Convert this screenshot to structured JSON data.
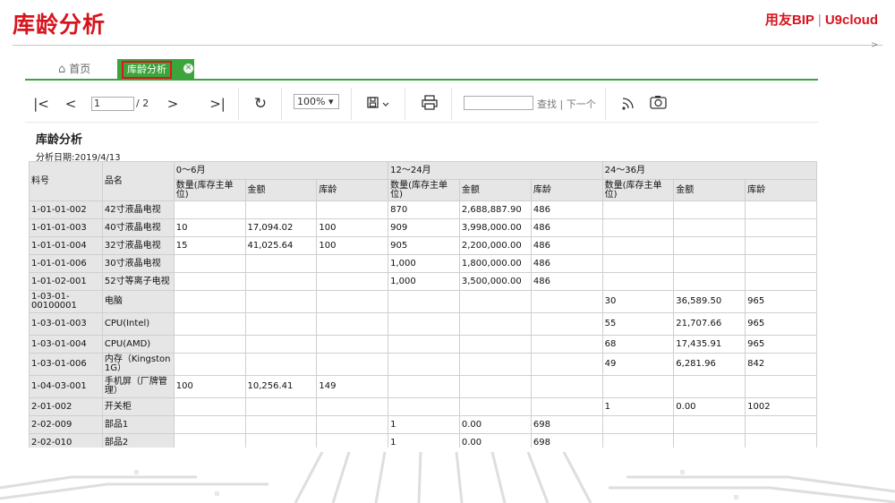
{
  "slide": {
    "title": "库龄分析",
    "brand_left": "用友BIP",
    "brand_right": "U9cloud"
  },
  "tabs": {
    "home": "首页",
    "active": "库龄分析"
  },
  "toolbar": {
    "page_value": "1",
    "page_total": "/ 2",
    "zoom": "100%",
    "find_label": "查找",
    "next_label": "下一个",
    "icons": [
      "first-page-icon",
      "prev-page-icon",
      "next-page-icon",
      "last-page-icon",
      "refresh-icon",
      "save-icon",
      "print-icon",
      "rss-icon",
      "camera-icon"
    ]
  },
  "report": {
    "title": "库龄分析",
    "date": "分析日期:2019/4/13",
    "col_code": "料号",
    "col_name": "品名",
    "groups": [
      "0～6月",
      "12～24月",
      "24～36月"
    ],
    "sub": [
      "数量(库存主单位)",
      "金额",
      "库龄"
    ],
    "rows": [
      {
        "code": "1-01-01-002",
        "name": "42寸液晶电视",
        "c": [
          "",
          "",
          "",
          "870",
          "2,688,887.90",
          "486",
          "",
          "",
          ""
        ]
      },
      {
        "code": "1-01-01-003",
        "name": "40寸液晶电视",
        "c": [
          "10",
          "17,094.02",
          "100",
          "909",
          "3,998,000.00",
          "486",
          "",
          "",
          ""
        ]
      },
      {
        "code": "1-01-01-004",
        "name": "32寸液晶电视",
        "c": [
          "15",
          "41,025.64",
          "100",
          "905",
          "2,200,000.00",
          "486",
          "",
          "",
          ""
        ]
      },
      {
        "code": "1-01-01-006",
        "name": "30寸液晶电视",
        "c": [
          "",
          "",
          "",
          "1,000",
          "1,800,000.00",
          "486",
          "",
          "",
          ""
        ]
      },
      {
        "code": "1-01-02-001",
        "name": "52寸等离子电视",
        "c": [
          "",
          "",
          "",
          "1,000",
          "3,500,000.00",
          "486",
          "",
          "",
          ""
        ]
      },
      {
        "code": "1-03-01-00100001",
        "name": "电脑",
        "c": [
          "",
          "",
          "",
          "",
          "",
          "",
          "30",
          "36,589.50",
          "965"
        ]
      },
      {
        "code": "1-03-01-003",
        "name": "CPU(Intel)",
        "c": [
          "",
          "",
          "",
          "",
          "",
          "",
          "55",
          "21,707.66",
          "965"
        ]
      },
      {
        "code": "1-03-01-004",
        "name": "CPU(AMD)",
        "c": [
          "",
          "",
          "",
          "",
          "",
          "",
          "68",
          "17,435.91",
          "965"
        ]
      },
      {
        "code": "1-03-01-006",
        "name": "内存（Kingston 1G）",
        "c": [
          "",
          "",
          "",
          "",
          "",
          "",
          "49",
          "6,281.96",
          "842"
        ]
      },
      {
        "code": "1-04-03-001",
        "name": "手机屏（厂牌管理）",
        "c": [
          "100",
          "10,256.41",
          "149",
          "",
          "",
          "",
          "",
          "",
          ""
        ]
      },
      {
        "code": "2-01-002",
        "name": "开关柜",
        "c": [
          "",
          "",
          "",
          "",
          "",
          "",
          "1",
          "0.00",
          "1002"
        ]
      },
      {
        "code": "2-02-009",
        "name": "部品1",
        "c": [
          "",
          "",
          "",
          "1",
          "0.00",
          "698",
          "",
          "",
          ""
        ]
      },
      {
        "code": "2-02-010",
        "name": "部品2",
        "c": [
          "",
          "",
          "",
          "1",
          "0.00",
          "698",
          "",
          "",
          ""
        ]
      }
    ]
  }
}
